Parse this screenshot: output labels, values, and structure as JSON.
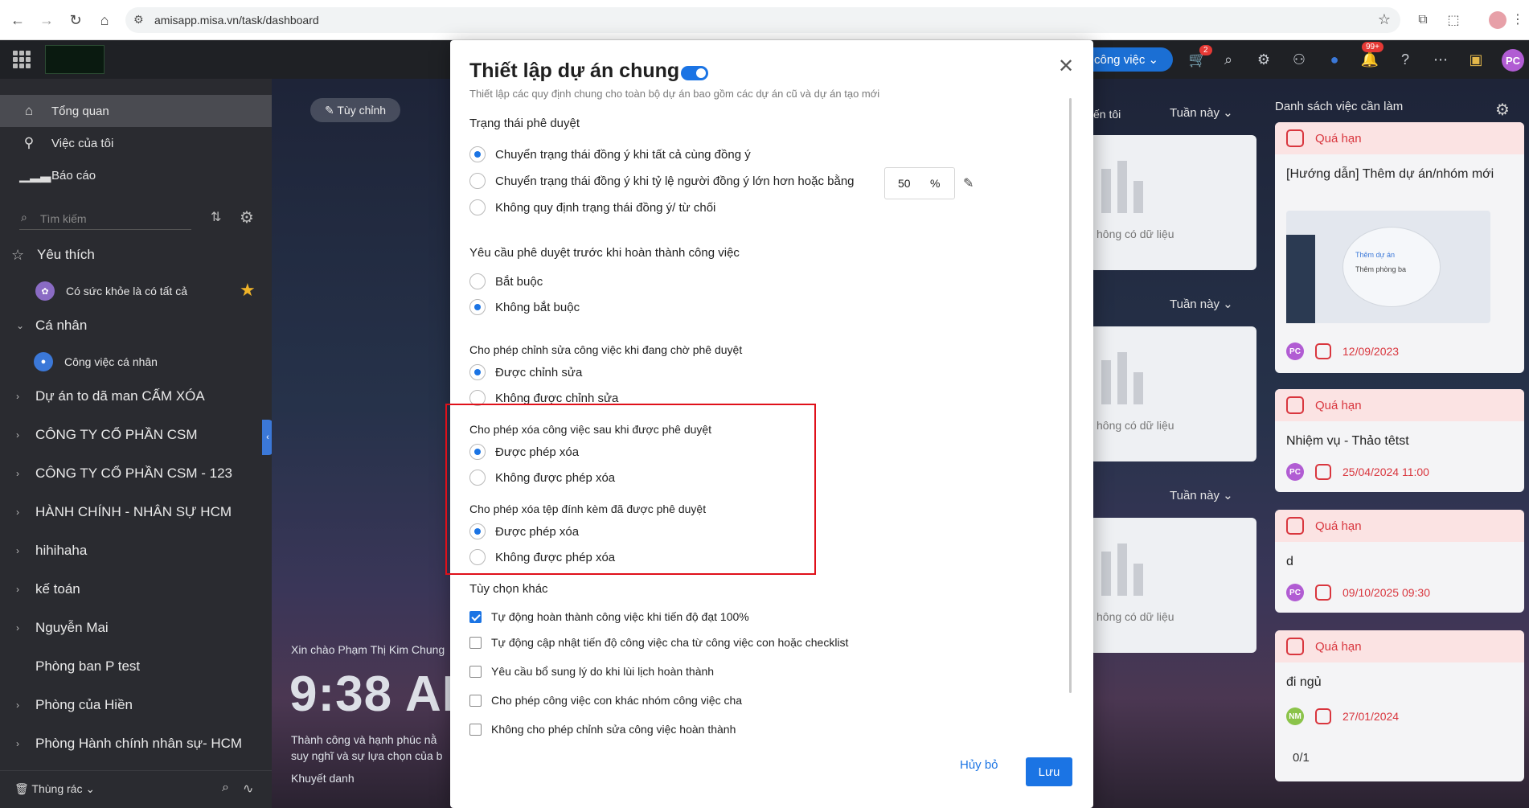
{
  "browser": {
    "url": "amisapp.misa.vn/task/dashboard"
  },
  "topbar": {
    "project_button": "công việc",
    "cart_badge": "2",
    "notif_badge": "99+",
    "user_initials": "PC"
  },
  "sidebar": {
    "items": [
      {
        "label": "Tổng quan",
        "icon": "home-icon"
      },
      {
        "label": "Việc của tôi",
        "icon": "user-task-icon"
      },
      {
        "label": "Báo cáo",
        "icon": "chart-icon"
      }
    ],
    "search_placeholder": "Tìm kiếm",
    "favorites_title": "Yêu thích",
    "favorite_item": "Có sức khỏe là có tất cả",
    "personal_title": "Cá nhân",
    "personal_item": "Công việc cá nhân",
    "groups": [
      "Dự án to dã man CẤM XÓA",
      "CÔNG TY CỔ PHẦN CSM",
      "CÔNG TY CỔ PHẦN CSM - 123",
      "HÀNH CHÍNH - NHÂN SỰ HCM",
      "hihihaha",
      "kế toán",
      "Nguyễn Mai",
      "Phòng ban P test",
      "Phòng của Hiền",
      "Phòng Hành chính nhân sự- HCM"
    ],
    "trash_label": "Thùng rác"
  },
  "dashboard": {
    "customize_label": "Tùy chỉnh",
    "greeting": "Xin chào Phạm Thị Kim Chung",
    "time": "9:38 AI",
    "quote": "Thành công và hạnh phúc nằ suy nghĩ và sự lựa chọn của b",
    "quote_author": "Khuyết danh",
    "my_tab": "ến tôi",
    "week_label": "Tuần này",
    "empty_text": "hông có dữ liệu",
    "todo_title": "Danh sách việc cần làm",
    "overdue_label": "Quá hạn",
    "tasks": [
      {
        "title": "[Hướng dẫn] Thêm dự án/nhóm mới",
        "date": "12/09/2023",
        "avatar": "PC"
      },
      {
        "title": "Nhiệm vụ - Thảo têtst",
        "date": "25/04/2024 11:00",
        "avatar": "PC"
      },
      {
        "title": "d",
        "date": "09/10/2025 09:30",
        "avatar": "PC"
      },
      {
        "title": "đi ngủ",
        "date": "27/01/2024",
        "avatar": "NM",
        "extra": "0/1"
      }
    ],
    "guide_img_label1": "Thêm dự án",
    "guide_img_label2": "Thêm phòng ba"
  },
  "modal": {
    "title": "Thiết lập dự án chung",
    "subtitle": "Thiết lập các quy định chung cho toàn bộ dự án bao gồm các dự án cũ và dự án tạo mới",
    "approval_status": {
      "title": "Trạng thái phê duyệt",
      "options": [
        "Chuyển trạng thái đồng ý khi tất cả cùng đồng ý",
        "Chuyển trạng thái đồng ý khi tỷ lệ người đồng ý lớn hơn hoặc bằng",
        "Không quy định trạng thái đồng ý/ từ chối"
      ],
      "selected": 0,
      "percent_value": "50",
      "percent_unit": "%"
    },
    "require_approval": {
      "title": "Yêu cầu phê duyệt trước khi hoàn thành công việc",
      "options": [
        "Bắt buộc",
        "Không bắt buộc"
      ],
      "selected": 1
    },
    "edit_pending": {
      "title": "Cho phép chỉnh sửa công việc khi đang chờ phê duyệt",
      "options": [
        "Được chỉnh sửa",
        "Không được chỉnh sửa"
      ],
      "selected": 0
    },
    "delete_task": {
      "title": "Cho phép xóa công việc sau khi được phê duyệt",
      "options": [
        "Được phép xóa",
        "Không được phép xóa"
      ],
      "selected": 0
    },
    "delete_attachment": {
      "title": "Cho phép xóa tệp đính kèm đã được phê duyệt",
      "options": [
        "Được phép xóa",
        "Không được phép xóa"
      ],
      "selected": 0
    },
    "other": {
      "title": "Tùy chọn khác",
      "options": [
        {
          "label": "Tự động hoàn thành công việc khi tiến độ đạt 100%",
          "checked": true
        },
        {
          "label": "Tự động cập nhật tiến độ công việc cha từ công việc con hoặc checklist",
          "checked": false
        },
        {
          "label": "Yêu cầu bổ sung lý do khi lùi lịch hoàn thành",
          "checked": false
        },
        {
          "label": "Cho phép công việc con khác nhóm công việc cha",
          "checked": false
        },
        {
          "label": "Không cho phép chỉnh sửa công việc hoàn thành",
          "checked": false
        }
      ]
    },
    "cancel_label": "Hủy bỏ",
    "save_label": "Lưu"
  }
}
